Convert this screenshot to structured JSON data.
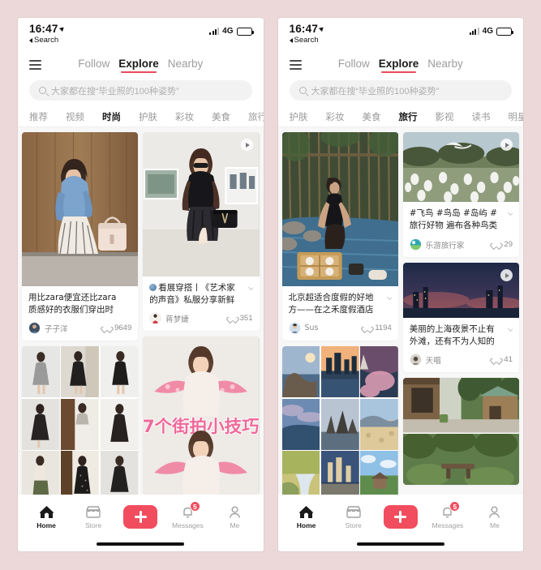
{
  "meta": {
    "background_color": "#ecd8d8",
    "accent_color": "#f14d5e"
  },
  "status_bar": {
    "time": "16:47",
    "back_label": "Search",
    "network": "4G",
    "location_icon": "location-arrow-icon",
    "battery_icon": "battery-icon"
  },
  "top_nav": {
    "menu_icon": "hamburger-menu-icon",
    "tabs": [
      {
        "label": "Follow",
        "active": false
      },
      {
        "label": "Explore",
        "active": true
      },
      {
        "label": "Nearby",
        "active": false
      }
    ]
  },
  "search": {
    "icon": "search-icon",
    "placeholder": "大家都在搜“毕业照的100种姿势”"
  },
  "left_phone": {
    "categories": [
      {
        "label": "推荐",
        "active": false
      },
      {
        "label": "视频",
        "active": false
      },
      {
        "label": "时尚",
        "active": true
      },
      {
        "label": "护肤",
        "active": false
      },
      {
        "label": "彩妆",
        "active": false
      },
      {
        "label": "美食",
        "active": false
      },
      {
        "label": "旅行",
        "active": false
      }
    ],
    "cards": [
      {
        "id": "card-zara",
        "column": "left",
        "title": "用比zara便宜还比zara质感好的衣服们穿出时",
        "author": "子子洋",
        "likes": "9649",
        "has_video": false,
        "thumb_height": 190,
        "art": "woman-blue-shirt-wood-wall"
      },
      {
        "id": "card-art-exhibit",
        "column": "right",
        "title": "看展穿搭丨《艺术家的声音》私服分享新鲜",
        "author": "蒋梦婕",
        "likes": "351",
        "has_video": true,
        "thumb_height": 178,
        "art": "woman-black-dress-gallery",
        "title_emoji": true
      },
      {
        "id": "card-dress-grid",
        "column": "left",
        "title": "",
        "author": "",
        "likes": "",
        "has_video": false,
        "thumb_height": 186,
        "art": "dress-collage-grid"
      },
      {
        "id": "card-street-tips",
        "column": "right",
        "title": "",
        "author": "",
        "likes": "",
        "has_video": false,
        "thumb_height": 195,
        "art": "street-photo-tips",
        "overlay_text": "7个街拍小技巧"
      }
    ]
  },
  "right_phone": {
    "categories": [
      {
        "label": "护肤",
        "active": false
      },
      {
        "label": "彩妆",
        "active": false
      },
      {
        "label": "美食",
        "active": false
      },
      {
        "label": "旅行",
        "active": true
      },
      {
        "label": "影视",
        "active": false
      },
      {
        "label": "读书",
        "active": false
      },
      {
        "label": "明星",
        "active": false
      }
    ],
    "cards": [
      {
        "id": "card-beijing-hotel",
        "column": "left",
        "title": "北京超适合度假的好地方——在之禾度假酒店",
        "author": "Sus",
        "likes": "1194",
        "has_video": false,
        "thumb_height": 190,
        "art": "woman-bamboo-pool"
      },
      {
        "id": "card-bird-island",
        "column": "right",
        "title": "#飞鸟 #鸟岛 #岛屿 #旅行好物 遍布各种鸟类的",
        "author": "乐游旅行家",
        "likes": "29",
        "has_video": true,
        "thumb_height": 86,
        "art": "bird-colony"
      },
      {
        "id": "card-shanghai-night",
        "column": "right",
        "title": "美丽的上海夜景不止有外滩，还有不为人知的",
        "author": "天唱",
        "likes": "41",
        "has_video": true,
        "thumb_height": 68,
        "art": "shanghai-night-skyline"
      },
      {
        "id": "card-landscape-grid",
        "column": "left",
        "title": "",
        "author": "",
        "likes": "",
        "has_video": false,
        "thumb_height": 186,
        "art": "landscape-collage-grid"
      },
      {
        "id": "card-wood-house",
        "column": "right",
        "title": "",
        "author": "",
        "likes": "",
        "has_video": false,
        "thumb_height": 132,
        "art": "wooden-house-forest"
      }
    ]
  },
  "tab_bar": {
    "items": [
      {
        "label": "Home",
        "icon": "home-icon",
        "active": true,
        "badge": ""
      },
      {
        "label": "Store",
        "icon": "store-icon",
        "active": false,
        "badge": ""
      },
      {
        "label": "",
        "icon": "plus-icon",
        "active": false,
        "badge": ""
      },
      {
        "label": "Messages",
        "icon": "bell-icon",
        "active": false,
        "badge": "5"
      },
      {
        "label": "Me",
        "icon": "person-icon",
        "active": false,
        "badge": ""
      }
    ]
  }
}
